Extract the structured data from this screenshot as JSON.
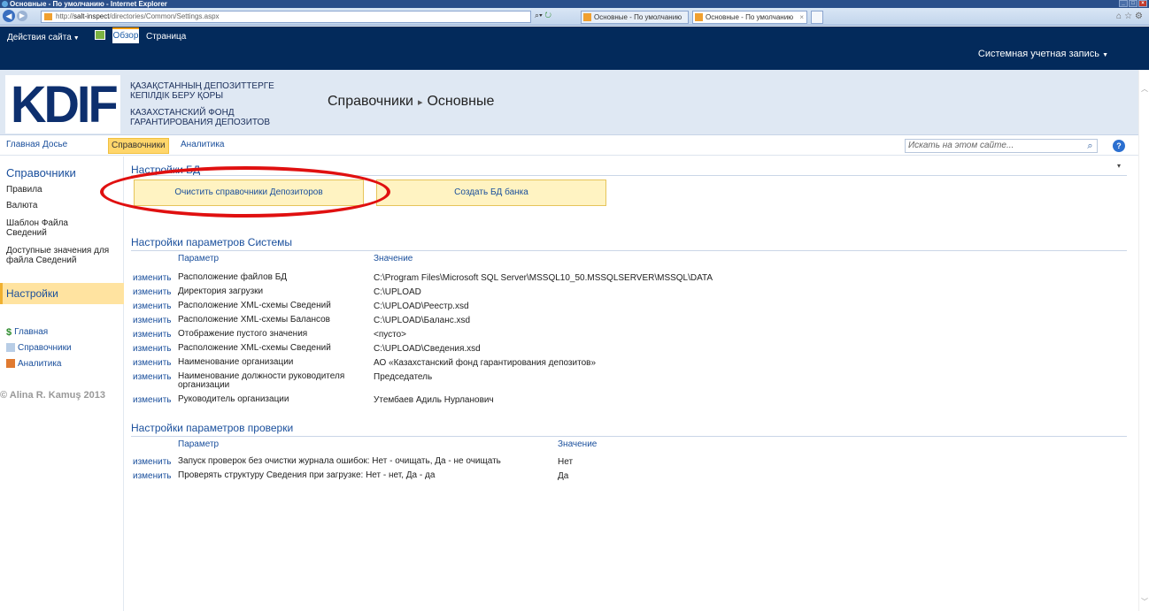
{
  "browser": {
    "window_title": "Основные - По умолчанию - Internet Explorer",
    "url_prefix": "http://",
    "url_host": "salt-inspect",
    "url_path": "/directories/Common/Settings.aspx",
    "tabs": [
      {
        "label": "Основные - По умолчанию"
      },
      {
        "label": "Основные - По умолчанию"
      }
    ]
  },
  "ribbon": {
    "site_actions": "Действия сайта",
    "tab_browse": "Обзор",
    "tab_page": "Страница",
    "account": "Системная учетная запись"
  },
  "header": {
    "logo_text": "KDIF",
    "org_kz_1": "ҚАЗАҚСТАННЫҢ ДЕПОЗИТТЕРГЕ",
    "org_kz_2": "КЕПІЛДІК БЕРУ ҚОРЫ",
    "org_ru_1": "КАЗАХСТАНСКИЙ ФОНД",
    "org_ru_2": "ГАРАНТИРОВАНИЯ ДЕПОЗИТОВ",
    "crumb_1": "Справочники",
    "crumb_2": "Основные"
  },
  "topnav": {
    "items": [
      "Главная",
      "Досье",
      "Справочники",
      "Аналитика"
    ],
    "search_placeholder": "Искать на этом сайте..."
  },
  "leftnav": {
    "heading": "Справочники",
    "items": [
      "Правила",
      "Валюта",
      "Шаблон Файла Сведений",
      "Доступные значения для файла Сведений"
    ],
    "selected": "Настройки",
    "links": [
      "Главная",
      "Справочники",
      "Аналитика"
    ],
    "copyright": "© Alina R. Kamuş 2013"
  },
  "main": {
    "db_title": "Настройки БД",
    "btn_clear": "Очистить справочники Депозиторов",
    "btn_create": "Создать БД банка",
    "sys_title": "Настройки параметров Системы",
    "col_param": "Параметр",
    "col_value": "Значение",
    "edit_label": "изменить",
    "sys_rows": [
      {
        "name": "Расположение файлов БД",
        "value": "C:\\Program Files\\Microsoft SQL Server\\MSSQL10_50.MSSQLSERVER\\MSSQL\\DATA"
      },
      {
        "name": "Директория загрузки",
        "value": "C:\\UPLOAD"
      },
      {
        "name": "Расположение XML-схемы Сведений",
        "value": "C:\\UPLOAD\\Реестр.xsd"
      },
      {
        "name": "Расположение XML-схемы Балансов",
        "value": "C:\\UPLOAD\\Баланс.xsd"
      },
      {
        "name": "Отображение пустого значения",
        "value": "<пусто>"
      },
      {
        "name": "Расположение XML-схемы Сведений",
        "value": "C:\\UPLOAD\\Сведения.xsd"
      },
      {
        "name": "Наименование организации",
        "value": "АО «Казахстанский фонд гарантирования депозитов»"
      },
      {
        "name": "Наименование должности руководителя организации",
        "value": "Председатель"
      },
      {
        "name": "Руководитель организации",
        "value": "Утембаев Адиль Нурланович"
      }
    ],
    "check_title": "Настройки параметров проверки",
    "check_rows": [
      {
        "name": "Запуск проверок без очистки журнала ошибок: Нет - очищать, Да - не очищать",
        "value": "Нет"
      },
      {
        "name": "Проверять структуру Сведения при загрузке: Нет - нет, Да - да",
        "value": "Да"
      }
    ]
  }
}
